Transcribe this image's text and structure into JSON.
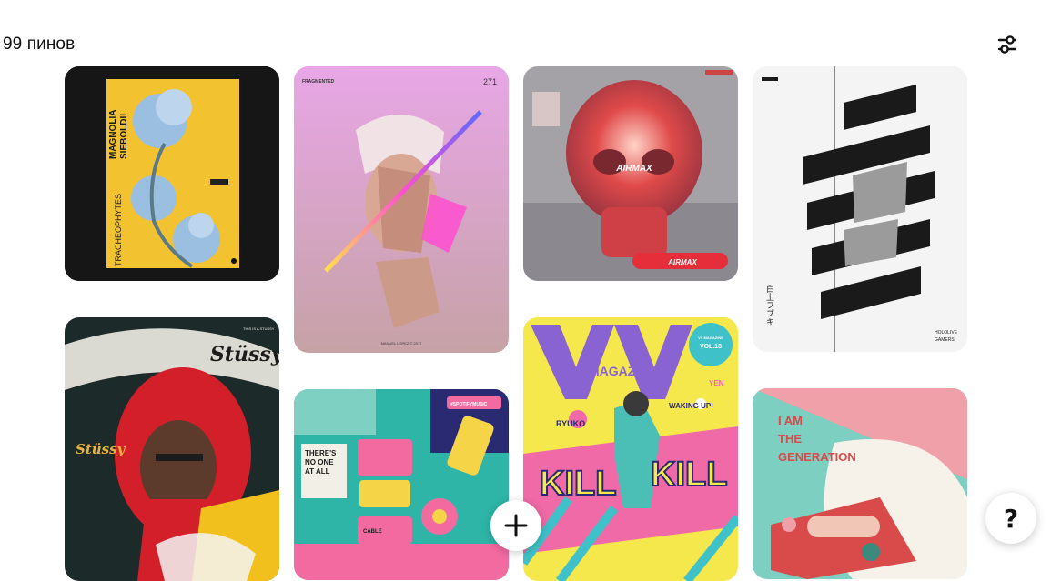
{
  "header": {
    "pin_count_label": "99 пинов",
    "filter_icon": "sliders-icon"
  },
  "pins": [
    {
      "name": "pin-magnolia-poster",
      "texts": [
        "MAGNOLIA",
        "SIEBOLDII",
        "TRACHEOPHYTES"
      ],
      "colors": {
        "bg": "#161616",
        "accent": "#f2c230",
        "flower": "#9bbfe0"
      }
    },
    {
      "name": "pin-fragmented-portrait",
      "texts": [
        "FRAGMENTED",
        "271",
        "MANUEL LOPEZ © 2017"
      ],
      "colors": {
        "bg_top": "#e8a6e6",
        "bg_bottom": "#c6a2a6",
        "accent": "#ff4fd0"
      }
    },
    {
      "name": "pin-red-skull",
      "texts": [
        "AIRMAX"
      ],
      "colors": {
        "bg": "#9e9ea0",
        "skull": "#e04a4a"
      }
    },
    {
      "name": "pin-hololive-fubuki",
      "texts": [
        "白上フブキ",
        "HOLOLIVE",
        "GAMERS"
      ],
      "colors": {
        "bg": "#f4f4f4",
        "stripe": "#1a1a1a"
      }
    },
    {
      "name": "pin-stussy-poster",
      "texts": [
        "THIS IS A STUSSY",
        "Stüssy"
      ],
      "colors": {
        "bg": "#1c2a2a",
        "hood": "#d21f2a"
      }
    },
    {
      "name": "pin-spotify-illustration",
      "texts": [
        "#SPOTIFYMUSIC",
        "THERE'S",
        "NO ONE",
        "AT ALL",
        "CABLE"
      ],
      "colors": {
        "bg": "#2fb5a8",
        "pink": "#f36aa1",
        "yellow": "#f6d447"
      }
    },
    {
      "name": "pin-vv-magazine",
      "texts": [
        "MAGAZINE",
        "VV MAGAZINE",
        "VOL.18",
        "YEN",
        "RYUKO",
        "WAKING UP!",
        "KILL",
        "KILL"
      ],
      "colors": {
        "bg": "#f5e84d",
        "purple": "#8a63d2",
        "pink": "#f06aa7",
        "teal": "#3fc1c9"
      }
    },
    {
      "name": "pin-i-am-the-generation",
      "texts": [
        "I AM",
        "THE",
        "GENERATION"
      ],
      "colors": {
        "bg": "#7ccfc1",
        "pink": "#f0a0a8",
        "red": "#d94a4a"
      }
    }
  ],
  "fab": {
    "add_icon": "plus-icon",
    "help_label": "?"
  }
}
